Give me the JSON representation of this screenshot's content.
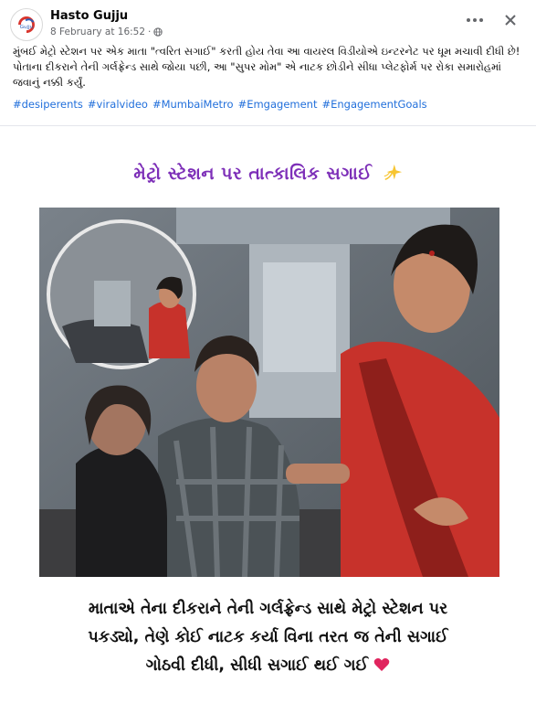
{
  "post": {
    "page_name": "Hasto Gujju",
    "timestamp": "8 February at 16:52",
    "separator": "·",
    "text": "મુંબઈ મેટ્રો સ્ટેશન પર એક માતા \"ત્વરિત સગાઈ\" કરતી હોય તેવા આ વાયરલ વિડીયોએ ઇન્ટરનેટ પર ધૂમ મચાવી દીધી છે! પોતાના દીકરાને તેની ગર્લફ્રેન્ડ સાથે જોયા પછી, આ \"સુપર મોમ\" એ નાટક છોડીને સીધા પ્લેટફોર્મ પર રોકા સમારોહમાં જવાનું નક્કી કર્યું.",
    "hashtags": [
      "#desiperents",
      "#viralvideo",
      "#MumbaiMetro",
      "#Emgagement",
      "#EngagementGoals"
    ],
    "avatar_text": "Gujju"
  },
  "media": {
    "heading": "મેટ્રો સ્ટેશન પર તાત્કાલિક સગાઈ",
    "caption_lines": [
      "માતાએ તેના દીકરાને તેની ગર્લફ્રેન્ડ સાથે મેટ્રો સ્ટેશન પર",
      "પકડ્યો, તેણે કોઈ નાટક કર્યા વિના તરત જ તેની સગાઈ",
      "ગોઠવી દીધી, સીધી સગાઈ થઈ ગઈ"
    ]
  },
  "icons": {
    "avatar": "page-logo-icon",
    "privacy": "globe-icon",
    "more": "more-options-icon",
    "close": "close-icon",
    "sparkle": "sparkle-icon",
    "heart": "heart-icon"
  },
  "colors": {
    "link": "#216fdb",
    "heading": "#7d2fb8",
    "heart": "#e0245e"
  }
}
